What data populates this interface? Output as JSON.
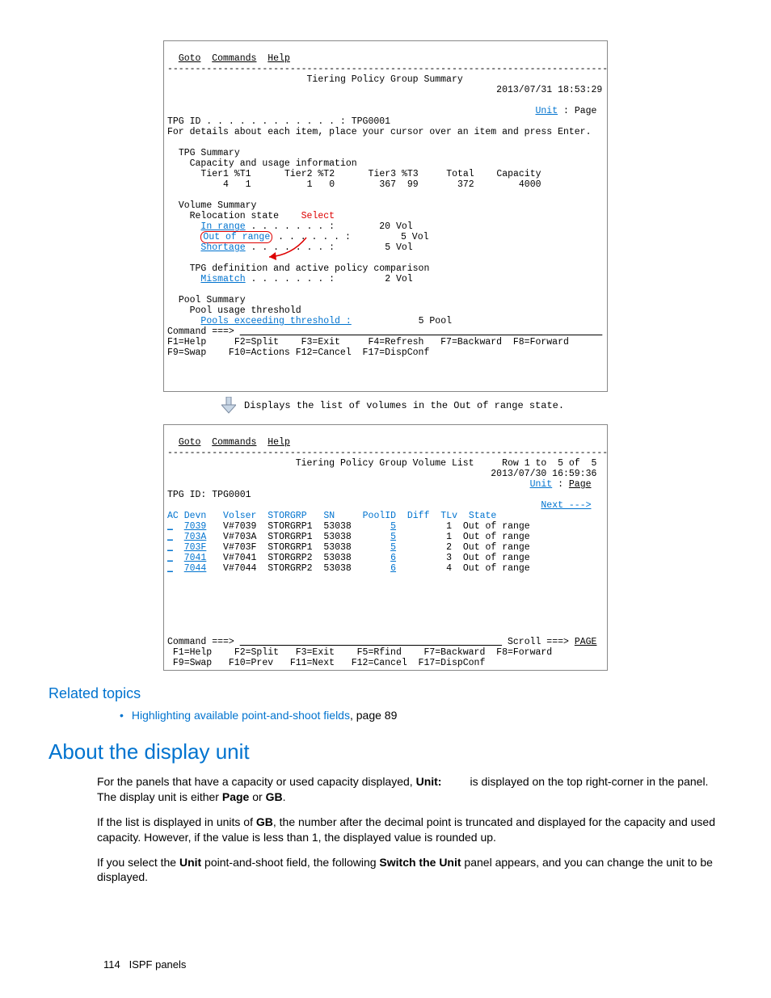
{
  "panel1": {
    "menu": {
      "goto": "Goto",
      "commands": "Commands",
      "help": "Help"
    },
    "divider": "-------------------------------------------------------------------------------",
    "title": "Tiering Policy Group Summary",
    "timestamp": "2013/07/31 18:53:29",
    "unit_label": "Unit",
    "unit_value": "Page",
    "tpg_id_label": "TPG ID . . . . . . . . . . . . : ",
    "tpg_id": "TPG0001",
    "instruction": "For details about each item, place your cursor over an item and press Enter.",
    "tpg_summary": {
      "heading": "TPG Summary",
      "sub1": "Capacity and usage information",
      "headers": {
        "tier1": "Tier1",
        "t1": "%T1",
        "tier2": "Tier2",
        "t2": "%T2",
        "tier3": "Tier3",
        "t3": "%T3",
        "total": "Total",
        "capacity": "Capacity"
      },
      "values": {
        "tier1": "4",
        "t1": "1",
        "tier2": "1",
        "t2": "0",
        "tier3": "367",
        "t3": "99",
        "total": "372",
        "capacity": "4000"
      }
    },
    "vol_summary": {
      "heading": "Volume Summary",
      "reloc": "Relocation state",
      "select": "Select",
      "rows": [
        {
          "label": "In range",
          "dots": " . . . . . . . :",
          "value": "20 Vol"
        },
        {
          "label": "Out of range",
          "dots": " . . . . . . :",
          "value": "5 Vol"
        },
        {
          "label": "Shortage",
          "dots": " . . . . . . . :",
          "value": "5 Vol"
        }
      ],
      "comparison": "TPG definition and active policy comparison",
      "mismatch": {
        "label": "Mismatch",
        "dots": " . . . . . . . :",
        "value": "2 Vol"
      }
    },
    "pool_summary": {
      "heading": "Pool Summary",
      "usage": "Pool usage threshold",
      "exceed": {
        "label": "Pools exceeding threshold :",
        "value": "5 Pool"
      }
    },
    "command": "Command ===>",
    "fkeys": {
      "row1": "F1=Help     F2=Split    F3=Exit     F4=Refresh   F7=Backward  F8=Forward",
      "row2": "F9=Swap    F10=Actions F12=Cancel  F17=DispConf"
    }
  },
  "between_annot": "Displays the list of volumes in the Out of range state.",
  "panel2": {
    "menu": {
      "goto": "Goto",
      "commands": "Commands",
      "help": "Help"
    },
    "divider": "-------------------------------------------------------------------------------",
    "title": "Tiering Policy Group Volume List",
    "row_info": "Row 1 to  5 of  5",
    "timestamp": "2013/07/30 16:59:36",
    "unit_label": "Unit",
    "unit_value": "Page",
    "tpg_id_label": "TPG ID:",
    "tpg_id": "TPG0001",
    "next": "Next --->",
    "headers": {
      "ac": "AC",
      "devn": "Devn",
      "volser": "Volser",
      "storgrp": "STORGRP",
      "sn": "SN",
      "poolid": "PoolID",
      "diff": "Diff",
      "tlv": "TLv",
      "state": "State"
    },
    "rows": [
      {
        "ac": "_",
        "devn": "7039",
        "volser": "V#7039",
        "storgrp": "STORGRP1",
        "sn": "53038",
        "poolid": "5",
        "diff": "",
        "tlv": "1",
        "state": "Out of range"
      },
      {
        "ac": "_",
        "devn": "703A",
        "volser": "V#703A",
        "storgrp": "STORGRP1",
        "sn": "53038",
        "poolid": "5",
        "diff": "",
        "tlv": "1",
        "state": "Out of range"
      },
      {
        "ac": "_",
        "devn": "703F",
        "volser": "V#703F",
        "storgrp": "STORGRP1",
        "sn": "53038",
        "poolid": "5",
        "diff": "",
        "tlv": "2",
        "state": "Out of range"
      },
      {
        "ac": "_",
        "devn": "7041",
        "volser": "V#7041",
        "storgrp": "STORGRP2",
        "sn": "53038",
        "poolid": "6",
        "diff": "",
        "tlv": "3",
        "state": "Out of range"
      },
      {
        "ac": "_",
        "devn": "7044",
        "volser": "V#7044",
        "storgrp": "STORGRP2",
        "sn": "53038",
        "poolid": "6",
        "diff": "",
        "tlv": "4",
        "state": "Out of range"
      }
    ],
    "command": "Command ===>",
    "scroll": "Scroll ===> ",
    "scroll_val": "PAGE",
    "fkeys": {
      "row1": " F1=Help    F2=Split   F3=Exit    F5=Rfind    F7=Backward  F8=Forward",
      "row2": " F9=Swap   F10=Prev   F11=Next   F12=Cancel  F17=DispConf"
    }
  },
  "related": {
    "heading": "Related topics",
    "link": "Highlighting available point-and-shoot fields",
    "page": ", page 89"
  },
  "about": {
    "heading": "About the display unit",
    "p1a": "For the panels that have a capacity or used capacity displayed, ",
    "p1b": "Unit:",
    "p1c": " is displayed on the top right-corner in the panel. The display unit is either ",
    "p1d": "Page",
    "p1e": " or ",
    "p1f": "GB",
    "p1g": ".",
    "p2a": "If the list is displayed in units of ",
    "p2b": "GB",
    "p2c": ", the number after the decimal point is truncated and displayed for the capacity and used capacity. However, if the value is less than 1, the displayed value is rounded up.",
    "p3a": "If you select the ",
    "p3b": "Unit",
    "p3c": " point-and-shoot field, the following ",
    "p3d": "Switch the Unit",
    "p3e": " panel appears, and you can change the unit to be displayed."
  },
  "footer": {
    "page": "114",
    "section": "ISPF panels"
  }
}
